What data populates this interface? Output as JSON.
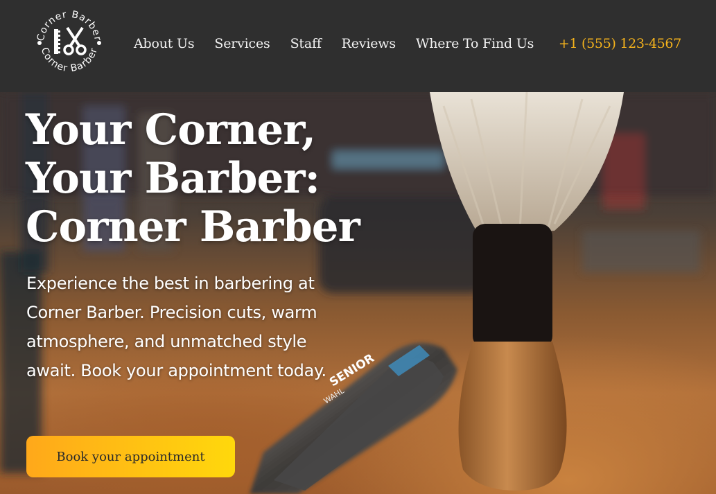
{
  "brand": {
    "logo_text_top": "Corner Barber",
    "logo_text_bottom": "Corner Barber",
    "logo_icon": "comb-and-scissors-icon"
  },
  "nav": {
    "items": [
      {
        "label": "About Us"
      },
      {
        "label": "Services"
      },
      {
        "label": "Staff"
      },
      {
        "label": "Reviews"
      },
      {
        "label": "Where To Find Us"
      }
    ],
    "phone": "+1 (555) 123-4567"
  },
  "hero": {
    "title_lines": [
      "Your Corner,",
      "Your Barber:",
      "Corner Barber"
    ],
    "text": "Experience the best in barbering at Corner Barber. Precision cuts, warm atmosphere, and unmatched style await. Book your appointment today.",
    "cta_label": "Book your appointment",
    "clipper_brand": "SENIOR",
    "clipper_maker": "WAHL"
  },
  "colors": {
    "header_bg": "#2f2f2f",
    "accent": "#f5b31c",
    "cta_start": "#ffa81a",
    "cta_end": "#ffd80c"
  }
}
